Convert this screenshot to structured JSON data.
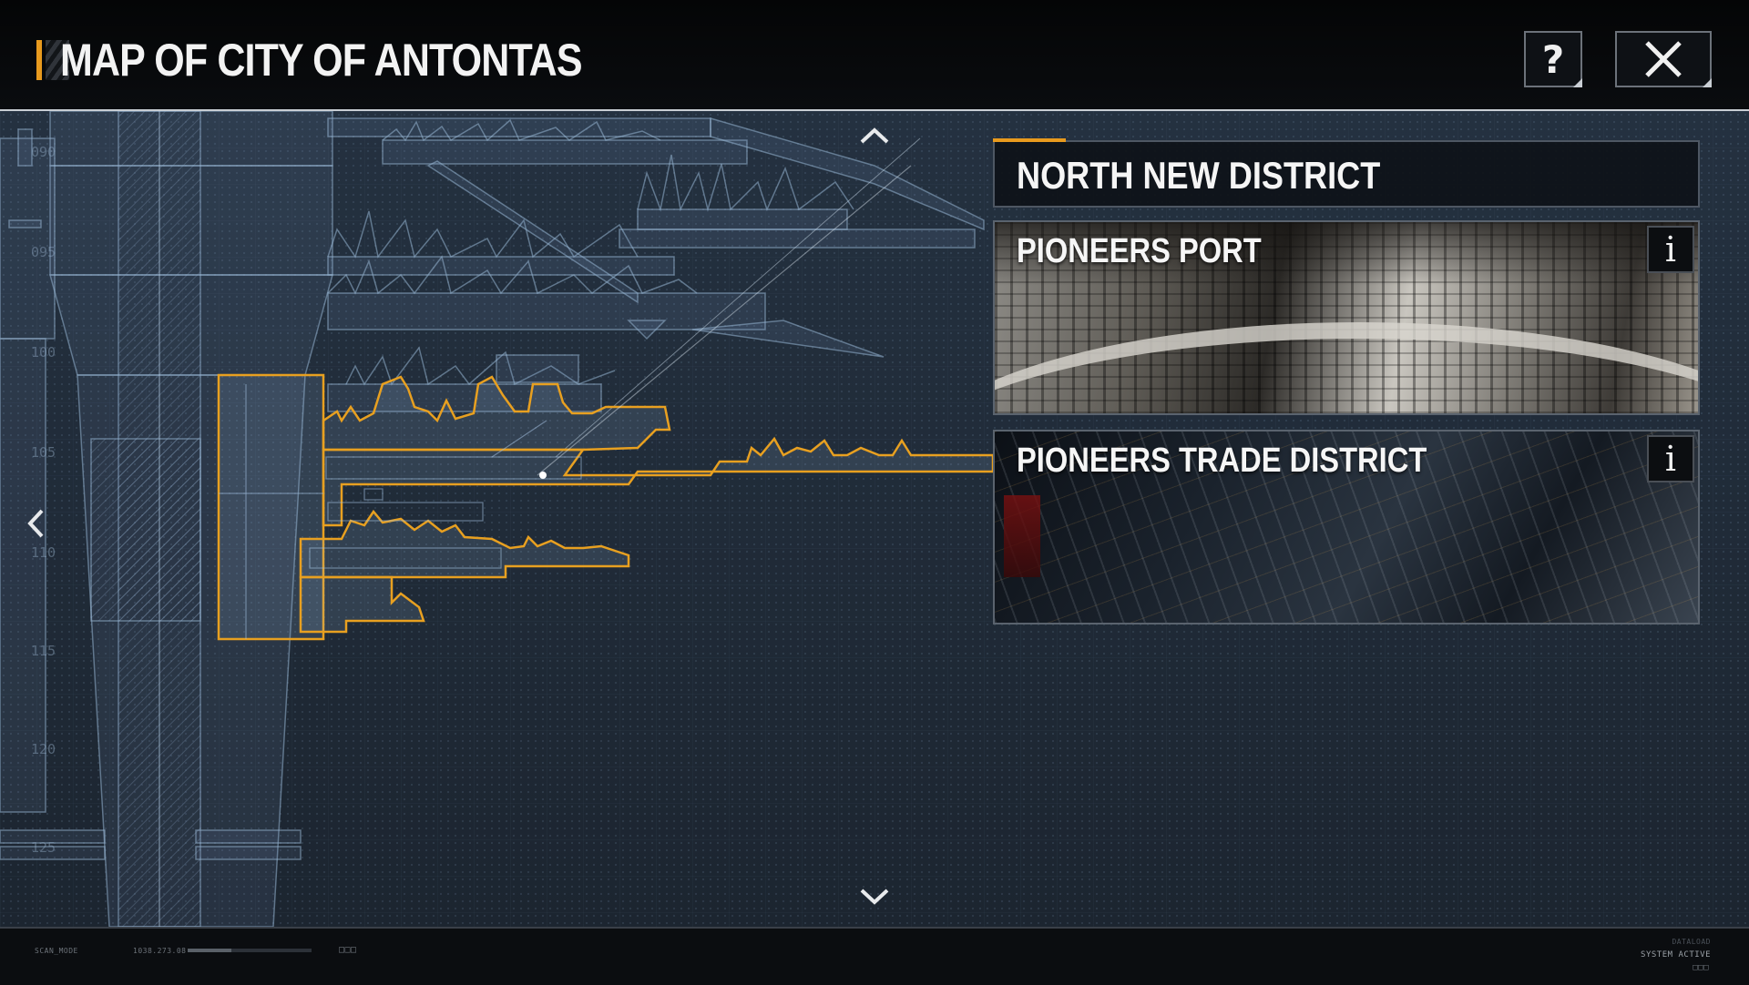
{
  "header": {
    "title": "MAP OF CITY OF ANTONTAS",
    "help_icon": "question-mark-icon",
    "help_label": "?",
    "close_icon": "close-x-icon"
  },
  "map": {
    "depth_labels": [
      "090",
      "095",
      "100",
      "105",
      "110",
      "115",
      "120",
      "125"
    ],
    "highlight_color": "#e8a020",
    "blueprint_color": "#8fb0d0"
  },
  "panel": {
    "district_title": "NORTH NEW DISTRICT",
    "cards": [
      {
        "title": "PIONEERS PORT",
        "info_label": "i"
      },
      {
        "title": "PIONEERS TRADE DISTRICT",
        "info_label": "i"
      }
    ]
  },
  "footer": {
    "mode": "SCAN_MODE",
    "coord": "1038.273.08",
    "squares": "□□□",
    "dataload": "DATALOAD",
    "status": "SYSTEM  ACTIVE",
    "squares2": "□□□"
  },
  "colors": {
    "accent": "#e89a1e",
    "background": "#1e2834",
    "header_bg": "#060709"
  }
}
